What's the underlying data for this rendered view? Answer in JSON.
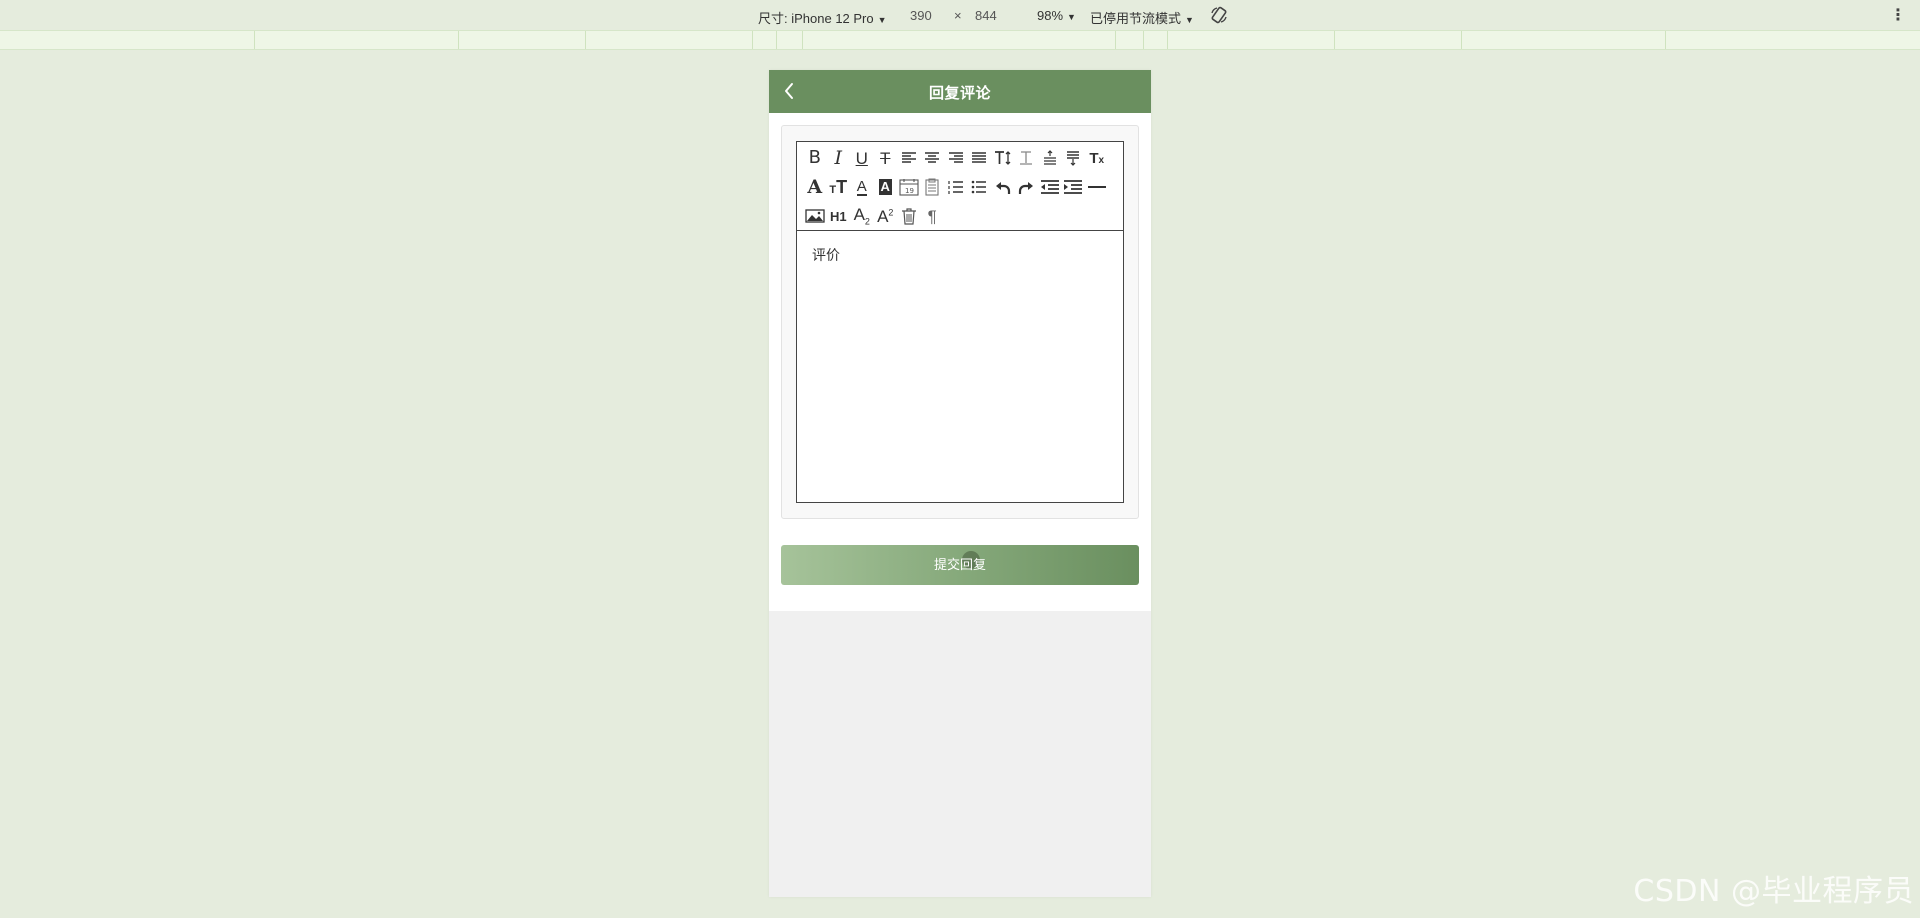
{
  "devtools": {
    "device_label": "尺寸: iPhone 12 Pro",
    "width": "390",
    "times": "×",
    "height": "844",
    "zoom": "98%",
    "throttle": "已停用节流模式",
    "more": "⋮"
  },
  "nav": {
    "title": "回复评论"
  },
  "editor": {
    "toolbar_row1": [
      "bold-icon",
      "italic-icon",
      "underline-icon",
      "strikethrough-icon",
      "align-left-icon",
      "align-center-icon",
      "align-right-icon",
      "align-justify-icon",
      "line-height-icon",
      "letter-spacing-icon",
      "margin-top-icon",
      "margin-bottom-icon",
      "clear-format-icon"
    ],
    "toolbar_row2": [
      "font-family-icon",
      "font-size-icon",
      "text-color-icon",
      "background-color-icon",
      "date-icon",
      "checklist-icon",
      "ordered-list-icon",
      "bullet-list-icon",
      "undo-icon",
      "redo-icon",
      "outdent-icon",
      "indent-icon",
      "horizontal-rule-icon"
    ],
    "toolbar_row3": [
      "image-icon",
      "heading-icon",
      "subscript-icon",
      "superscript-icon",
      "delete-icon",
      "paragraph-icon"
    ],
    "content": "评价",
    "h1_label": "H1"
  },
  "submit_label": "提交回复",
  "watermark": "CSDN @毕业程序员",
  "colors": {
    "page_bg": "#e5ecdd",
    "nav_bg": "#6a8f5f",
    "button_gradient_start": "#a6c39a",
    "button_gradient_end": "#6a8f5f"
  }
}
